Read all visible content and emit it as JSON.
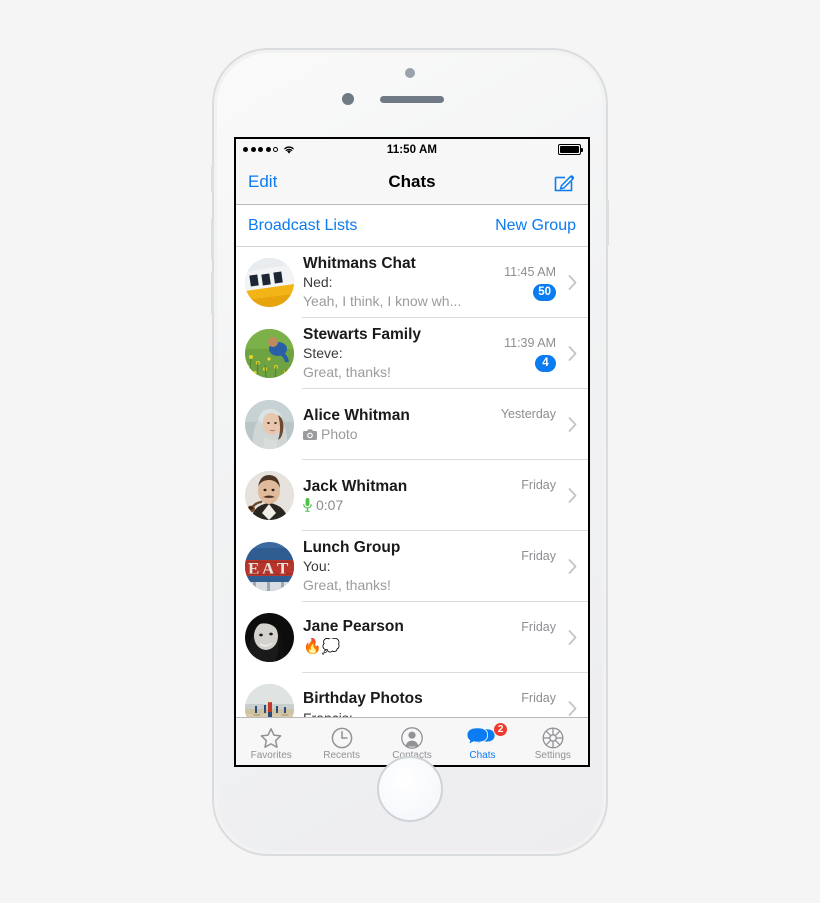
{
  "device": {
    "name": "iphone-mockup",
    "hardware": {
      "earpiece": "earpiece-speaker",
      "front_camera": "front-camera",
      "sensor": "proximity-sensor",
      "home_button": "home-button"
    }
  },
  "status_bar": {
    "signal_dots_filled": 4,
    "signal_dots_empty": 1,
    "wifi": "wifi-icon",
    "time": "11:50 AM",
    "battery": "battery-full-icon"
  },
  "nav_bar": {
    "edit_label": "Edit",
    "title": "Chats",
    "compose_icon": "compose-icon"
  },
  "broadcast_bar": {
    "broadcast_label": "Broadcast Lists",
    "new_group_label": "New Group"
  },
  "colors": {
    "accent_blue": "#0b7bf1",
    "badge_blue": "#0b7bf1",
    "badge_red": "#f03a2e",
    "preview_gray": "#9b9b9d",
    "time_gray": "#8e8e93",
    "bar_gray": "#f7f7f7"
  },
  "chats": [
    {
      "name": "Whitmans Chat",
      "sender": "Ned:",
      "preview": "Yeah, I think, I know wh...",
      "time": "11:45 AM",
      "badge": "50",
      "avatar": "tram-photo-avatar",
      "attachment": null
    },
    {
      "name": "Stewarts Family",
      "sender": "Steve:",
      "preview": "Great, thanks!",
      "time": "11:39 AM",
      "badge": "4",
      "avatar": "child-in-field-avatar",
      "attachment": null
    },
    {
      "name": "Alice Whitman",
      "sender": "",
      "preview": "Photo",
      "time": "Yesterday",
      "badge": "",
      "avatar": "woman-hoodie-avatar",
      "attachment": "camera-icon"
    },
    {
      "name": "Jack Whitman",
      "sender": "",
      "preview": "0:07",
      "time": "Friday",
      "badge": "",
      "avatar": "man-with-pipe-avatar",
      "attachment": "microphone-icon"
    },
    {
      "name": "Lunch Group",
      "sender": "You:",
      "preview": "Great, thanks!",
      "time": "Friday",
      "badge": "",
      "avatar": "eat-sign-avatar",
      "attachment": null
    },
    {
      "name": "Jane Pearson",
      "sender": "",
      "preview": "🔥💭",
      "time": "Friday",
      "badge": "",
      "avatar": "woman-bw-portrait-avatar",
      "attachment": null
    },
    {
      "name": "Birthday Photos",
      "sender": "Francis:",
      "preview": "",
      "time": "Friday",
      "badge": "",
      "avatar": "beach-photo-avatar",
      "attachment": null
    }
  ],
  "tab_bar": {
    "items": [
      {
        "label": "Favorites",
        "icon": "star-icon",
        "active": false,
        "badge": ""
      },
      {
        "label": "Recents",
        "icon": "clock-icon",
        "active": false,
        "badge": ""
      },
      {
        "label": "Contacts",
        "icon": "person-icon",
        "active": false,
        "badge": ""
      },
      {
        "label": "Chats",
        "icon": "chat-bubbles-icon",
        "active": true,
        "badge": "2"
      },
      {
        "label": "Settings",
        "icon": "gear-icon",
        "active": false,
        "badge": ""
      }
    ]
  }
}
